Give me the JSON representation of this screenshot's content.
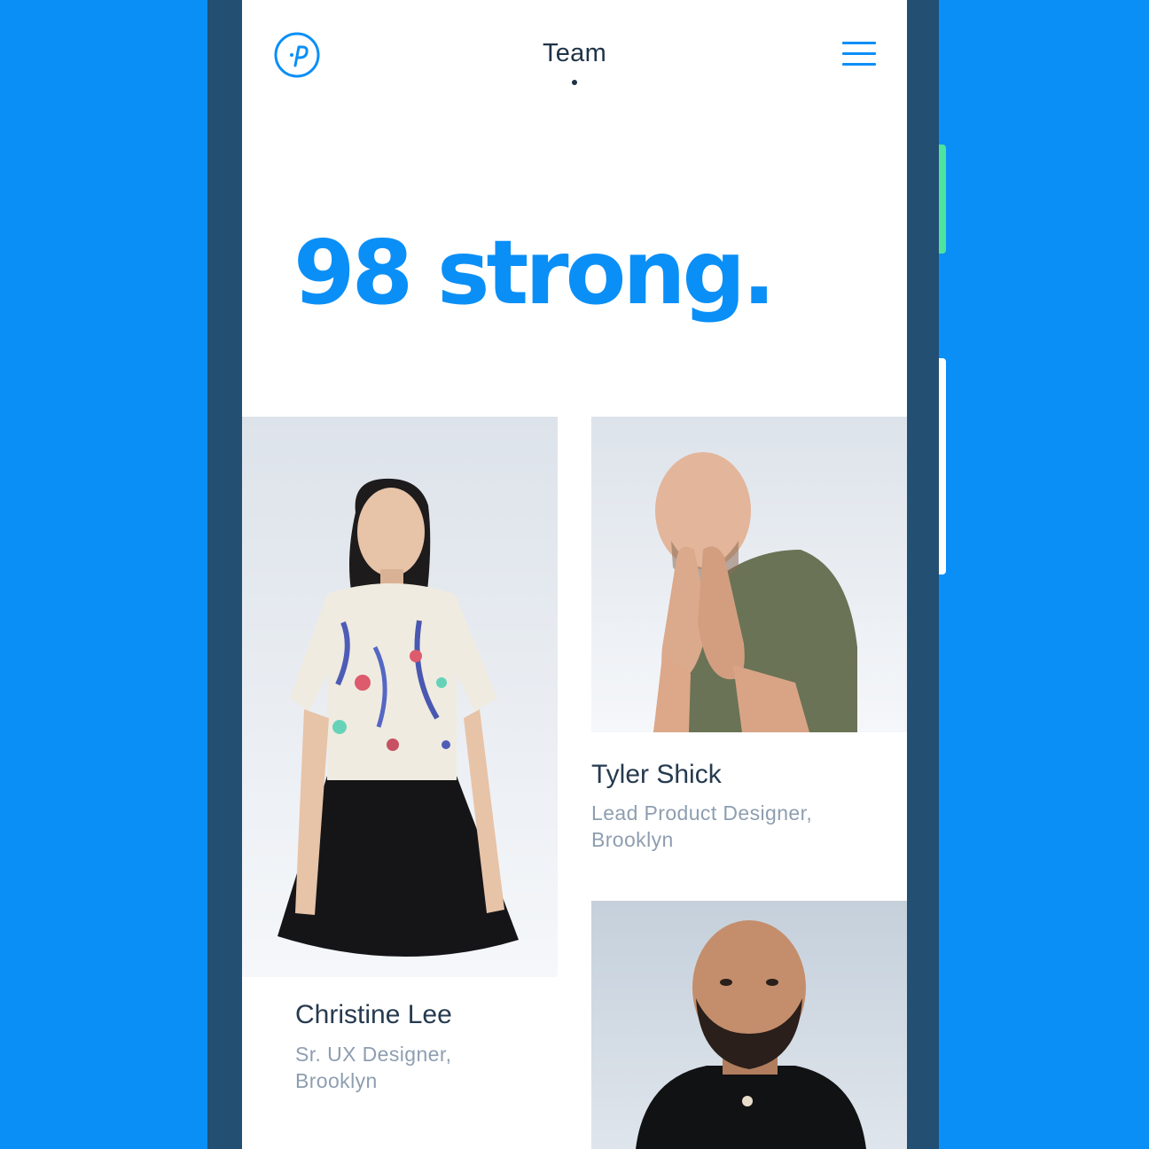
{
  "nav": {
    "title": "Team",
    "logo_icon": "circle-p-logo-icon",
    "menu_icon": "hamburger-menu-icon"
  },
  "hero": {
    "headline": "98 strong."
  },
  "team": [
    {
      "name": "Christine Lee",
      "role_line1": "Sr. UX Designer,",
      "role_line2": "Brooklyn"
    },
    {
      "name": "Tyler Shick",
      "role_line1": "Lead Product Designer,",
      "role_line2": "Brooklyn"
    },
    {
      "name": "",
      "role_line1": "",
      "role_line2": ""
    }
  ],
  "colors": {
    "background": "#0a8ff7",
    "device_frame": "#234f72",
    "accent_blue": "#0a8ff7",
    "accent_green": "#4fe3a0",
    "name_text": "#263a4f",
    "role_text": "#8e9eb0"
  }
}
